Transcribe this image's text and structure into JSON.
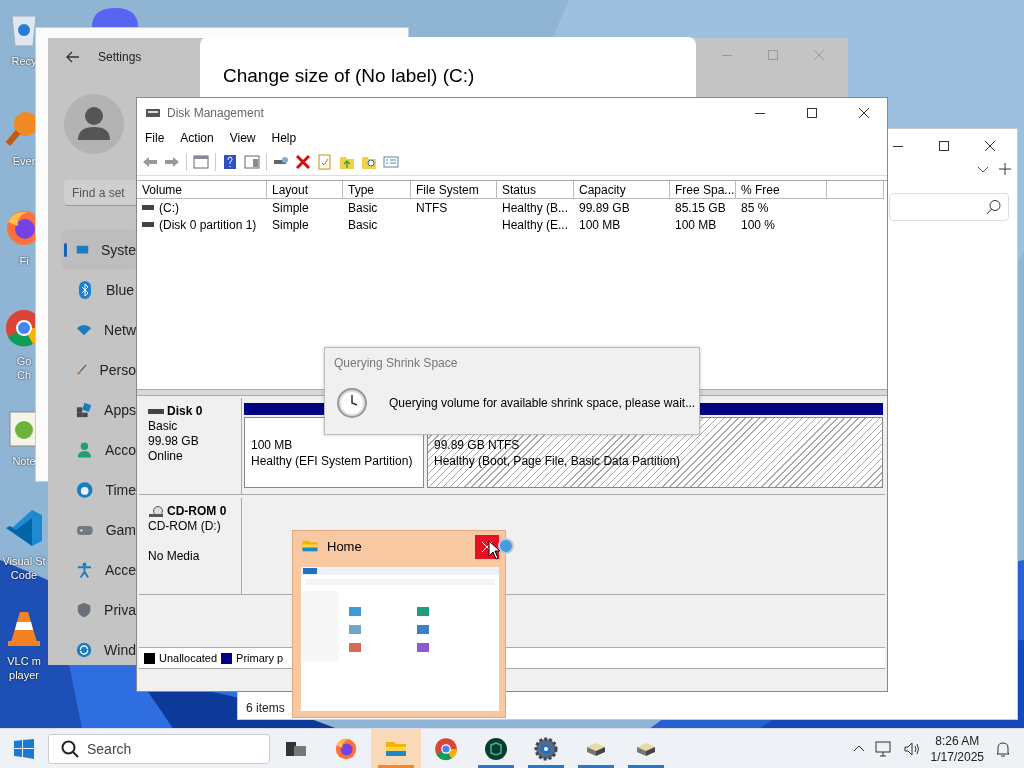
{
  "desktop_icons": [
    {
      "kind": "recycle",
      "label_lines": [
        "Recy"
      ]
    },
    {
      "kind": "everything",
      "label_lines": [
        "Ever"
      ]
    },
    {
      "kind": "firefox",
      "label_lines": [
        "Fi"
      ]
    },
    {
      "kind": "chrome",
      "label_lines": [
        "Go",
        "Ch"
      ]
    },
    {
      "kind": "notepad",
      "label_lines": [
        "Note"
      ]
    },
    {
      "kind": "vscode",
      "label_lines": [
        "Visual St",
        "Code"
      ]
    },
    {
      "kind": "vlc",
      "label_lines": [
        "VLC m",
        "player"
      ]
    }
  ],
  "settings": {
    "title": "Settings",
    "search_placeholder": "Find a set",
    "nav": [
      {
        "kind": "system",
        "label": "Syste",
        "selected": true
      },
      {
        "kind": "bluetooth",
        "label": "Blue",
        "selected": false
      },
      {
        "kind": "network",
        "label": "Netw",
        "selected": false
      },
      {
        "kind": "personalization",
        "label": "Perso",
        "selected": false
      },
      {
        "kind": "apps",
        "label": "Apps",
        "selected": false
      },
      {
        "kind": "accounts",
        "label": "Acco",
        "selected": false
      },
      {
        "kind": "time",
        "label": "Time",
        "selected": false
      },
      {
        "kind": "gaming",
        "label": "Gam",
        "selected": false
      },
      {
        "kind": "accessibility",
        "label": "Acce",
        "selected": false
      },
      {
        "kind": "privacy",
        "label": "Priva",
        "selected": false
      },
      {
        "kind": "update",
        "label": "Wind",
        "selected": false
      }
    ]
  },
  "change_size_dialog": {
    "title": "Change size of (No label) (C:)"
  },
  "explorer": {
    "status": "6 items"
  },
  "disk_management": {
    "title": "Disk Management",
    "menu": [
      "File",
      "Action",
      "View",
      "Help"
    ],
    "volume_table": {
      "columns": [
        "Volume",
        "Layout",
        "Type",
        "File System",
        "Status",
        "Capacity",
        "Free Spa...",
        "% Free"
      ],
      "rows": [
        [
          "(C:)",
          "Simple",
          "Basic",
          "NTFS",
          "Healthy (B...",
          "99.89 GB",
          "85.15 GB",
          "85 %"
        ],
        [
          "(Disk 0 partition 1)",
          "Simple",
          "Basic",
          "",
          "Healthy (E...",
          "100 MB",
          "100 MB",
          "100 %"
        ]
      ]
    },
    "disks": [
      {
        "kind": "disk",
        "name": "Disk 0",
        "lines": [
          "Basic",
          "99.98 GB",
          "Online"
        ],
        "partitions": [
          {
            "size": "100 MB",
            "status": "Healthy (EFI System Partition)",
            "hatched": false
          },
          {
            "size": "99.89 GB NTFS",
            "status": "Healthy (Boot, Page File, Basic Data Partition)",
            "hatched": true
          }
        ]
      },
      {
        "kind": "cdrom",
        "name": "CD-ROM 0",
        "lines": [
          "CD-ROM (D:)",
          "No Media"
        ]
      }
    ],
    "legend": [
      {
        "label": "Unallocated",
        "color": "#000000"
      },
      {
        "label": "Primary p",
        "color": "#000080"
      }
    ]
  },
  "query_dialog": {
    "title": "Querying Shrink Space",
    "message": "Querying volume for available shrink space, please wait..."
  },
  "thumbnail": {
    "title": "Home"
  },
  "taskbar": {
    "search_placeholder": "Search",
    "apps": [
      {
        "kind": "taskview",
        "running": false,
        "selected": false
      },
      {
        "kind": "firefox",
        "running": false,
        "selected": false
      },
      {
        "kind": "explorer",
        "running": true,
        "selected": true
      },
      {
        "kind": "chrome",
        "running": false,
        "selected": false
      },
      {
        "kind": "terminal",
        "running": true,
        "selected": false
      },
      {
        "kind": "settings",
        "running": true,
        "selected": false
      },
      {
        "kind": "diskmgmt",
        "running": true,
        "selected": false
      },
      {
        "kind": "diskmgmt",
        "running": true,
        "selected": false
      }
    ],
    "time": "8:26 AM",
    "date": "1/17/2025"
  }
}
